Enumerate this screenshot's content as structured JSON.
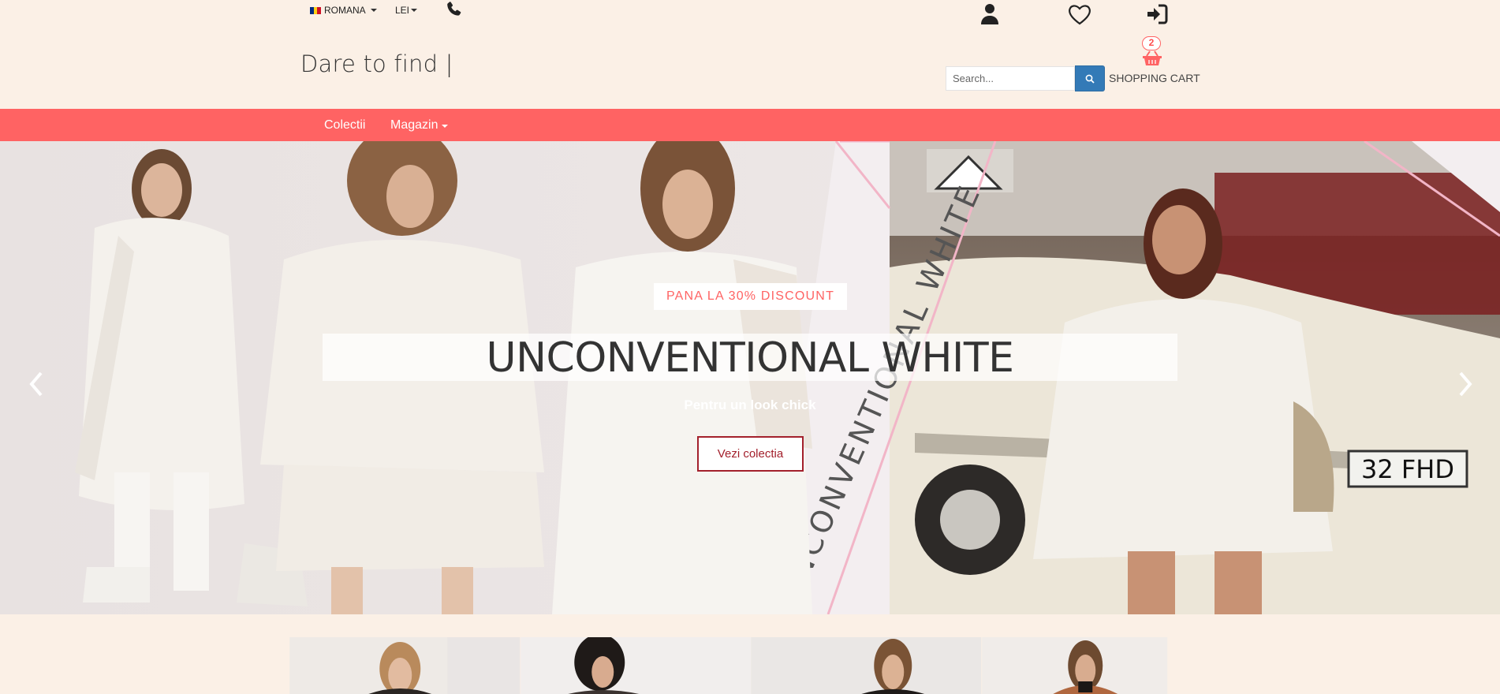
{
  "header": {
    "language": "ROMANA",
    "currency": "LEI",
    "brand_text": "Dare to find |",
    "search_placeholder": "Search...",
    "cart_count": "2",
    "cart_label": "SHOPPING CART",
    "icons": [
      "phone-icon",
      "user-icon",
      "heart-icon",
      "login-icon",
      "search-icon",
      "basket-icon"
    ]
  },
  "nav": {
    "items": [
      {
        "label": "Colectii"
      },
      {
        "label": "Magazin"
      }
    ]
  },
  "hero": {
    "badge": "PANA LA 30% DISCOUNT",
    "title": "UNCONVENTIONAL WHITE",
    "subtitle": "Pentru un look chick",
    "cta_label": "Vezi colectia",
    "diagonal_text": "UNCONVENTIONAL WHITE",
    "plate_text": "32 FHD"
  },
  "colors": {
    "page_bg": "#fbf0e6",
    "nav_bg": "#ff6363",
    "accent": "#ff6363",
    "cta_border": "#a3202c",
    "search_btn": "#337ab7"
  }
}
